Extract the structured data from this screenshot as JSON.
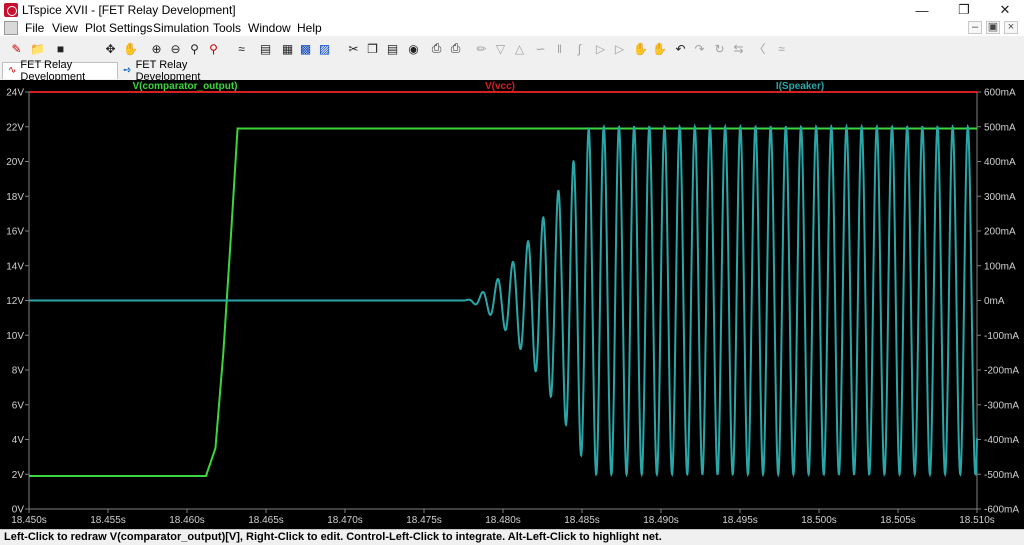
{
  "window": {
    "title": "LTspice XVII - [FET Relay Development]"
  },
  "menu": {
    "items": [
      "File",
      "View",
      "Plot Settings",
      "Simulation",
      "Tools",
      "Window",
      "Help"
    ]
  },
  "toolbar": {
    "icons": [
      "halt-icon",
      "open-folder-icon",
      "save-icon",
      "run-icon",
      "pan-hand-icon",
      "zoom-in-icon",
      "zoom-out-icon",
      "zoom-area-icon",
      "zoom-cancel-icon",
      "autorange-icon",
      "tile-horizontal-icon",
      "tile-vertical-icon",
      "cascade-icon",
      "cut-icon",
      "copy-icon",
      "find-icon",
      "print-icon",
      "print-setup-icon",
      "wire-icon",
      "ground-icon",
      "label-net-icon",
      "resistor-icon",
      "capacitor-icon",
      "inductor-icon",
      "diode-icon",
      "component-icon",
      "move-icon",
      "drag-icon",
      "undo-icon",
      "redo-icon",
      "rotate-icon",
      "mirror-icon",
      "text-icon",
      "spice-directive-icon"
    ]
  },
  "tabs": [
    {
      "label": "FET Relay Development",
      "icon": "waveform-icon"
    },
    {
      "label": "FET Relay Development",
      "icon": "schematic-icon"
    }
  ],
  "colors": {
    "vcomp": "#3cd63c",
    "vcc": "#d42020",
    "speaker": "#2aa6a8",
    "background": "#000000",
    "axis": "#808080"
  },
  "status": {
    "text": "Left-Click to redraw V(comparator_output)[V],  Right-Click to edit. Control-Left-Click to integrate. Alt-Left-Click to highlight net."
  },
  "chart_data": {
    "type": "line",
    "xlabel": "",
    "ylabel": "",
    "x_ticks": [
      "18.450s",
      "18.455s",
      "18.460s",
      "18.465s",
      "18.470s",
      "18.475s",
      "18.480s",
      "18.485s",
      "18.490s",
      "18.495s",
      "18.500s",
      "18.505s",
      "18.510s"
    ],
    "y_left_ticks": [
      "24V",
      "22V",
      "20V",
      "18V",
      "16V",
      "14V",
      "12V",
      "10V",
      "8V",
      "6V",
      "4V",
      "2V",
      "0V"
    ],
    "y_right_ticks": [
      "600mA",
      "500mA",
      "400mA",
      "300mA",
      "200mA",
      "100mA",
      "0mA",
      "-100mA",
      "-200mA",
      "-300mA",
      "-400mA",
      "-500mA",
      "-600mA"
    ],
    "xlim": [
      18.45,
      18.51
    ],
    "ylim_left": [
      0,
      24
    ],
    "ylim_right": [
      -600,
      600
    ],
    "grid": false,
    "series": [
      {
        "name": "V(comparator_output)",
        "axis": "left",
        "points": [
          [
            18.45,
            1.9
          ],
          [
            18.4612,
            1.9
          ],
          [
            18.4618,
            3.5
          ],
          [
            18.4623,
            9
          ],
          [
            18.4628,
            16
          ],
          [
            18.4632,
            21.9
          ],
          [
            18.51,
            21.9
          ]
        ]
      },
      {
        "name": "V(vcc)",
        "axis": "left",
        "points": [
          [
            18.45,
            24
          ],
          [
            18.51,
            24
          ]
        ]
      },
      {
        "name": "I(Speaker)",
        "axis": "right",
        "oscillation": {
          "baseline_until": 18.4775,
          "ramp_start": 18.4775,
          "full_amplitude_at": 18.4855,
          "amplitude": 500,
          "period": 0.00096,
          "start": 18.4775,
          "end": 18.51
        }
      }
    ]
  }
}
